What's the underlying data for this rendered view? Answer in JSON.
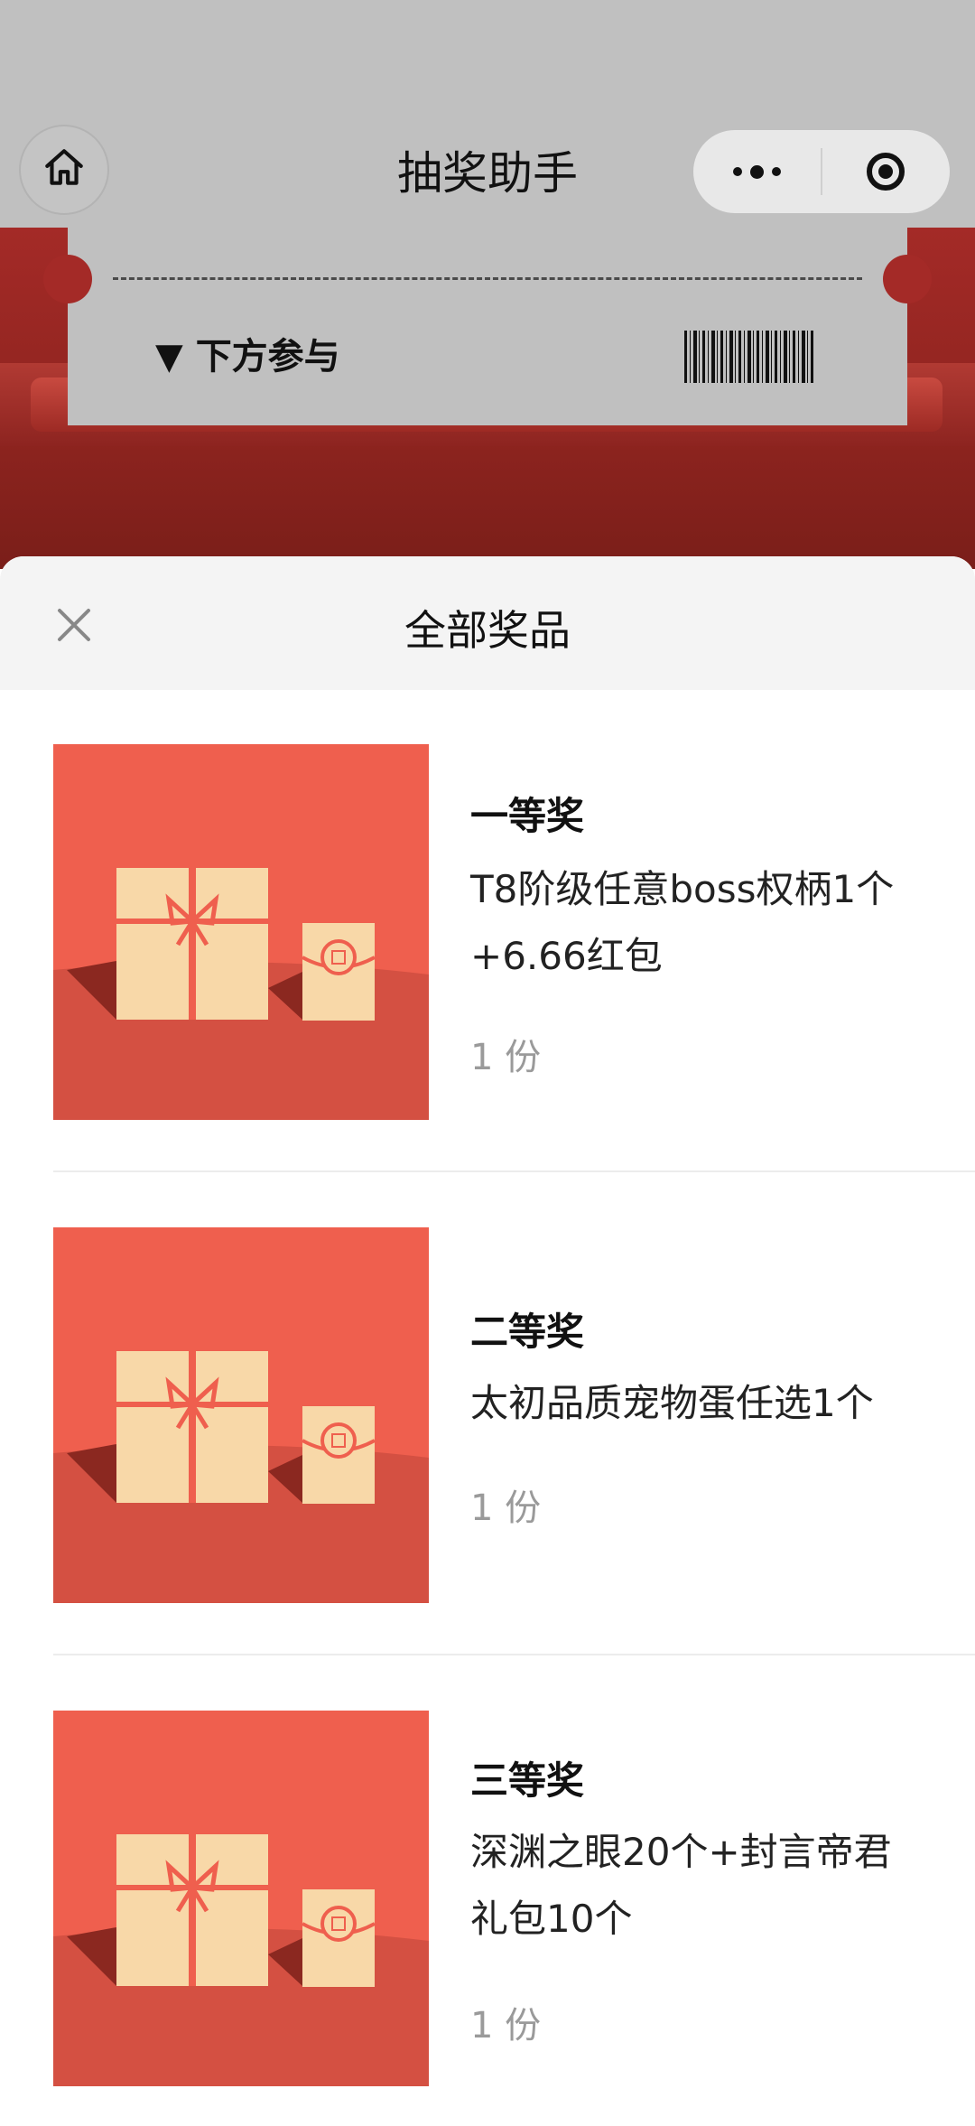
{
  "nav": {
    "title": "抽奖助手",
    "home_icon": "home-icon",
    "more_icon": "more-dots-icon",
    "close_miniprogram_icon": "target-icon"
  },
  "ticket": {
    "participate_label": "▼ 下方参与"
  },
  "sheet": {
    "title": "全部奖品",
    "close_icon": "close-icon"
  },
  "prizes": [
    {
      "rank": "一等奖",
      "desc_line1": "T8阶级任意boss权柄1个",
      "desc_line2": "+6.66红包",
      "count": "1 份"
    },
    {
      "rank": "二等奖",
      "desc_line1": "太初品质宠物蛋任选1个",
      "desc_line2": "",
      "count": "1 份"
    },
    {
      "rank": "三等奖",
      "desc_line1": "深渊之眼20个+封言帝君",
      "desc_line2": "礼包10个",
      "count": "1 份"
    }
  ],
  "colors": {
    "prize_bg": "#ef5f4e",
    "prize_floor": "#d45042",
    "gift_box": "#f8d8a8",
    "header_gray": "#c0c0c0",
    "header_red": "#a42a27"
  }
}
